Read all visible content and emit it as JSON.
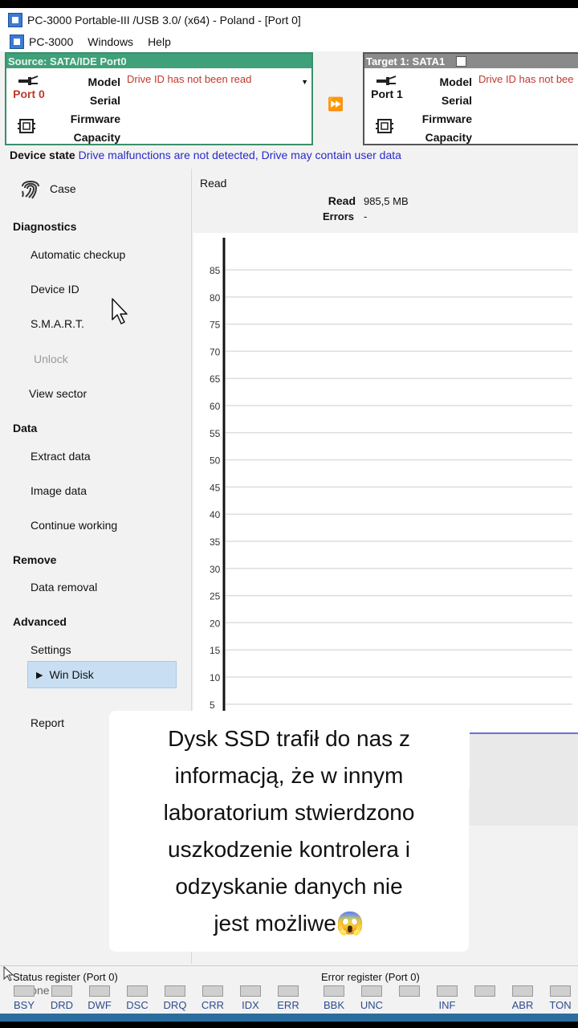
{
  "window": {
    "title": "PC-3000 Portable-III /USB 3.0/ (x64) - Poland - [Port 0]"
  },
  "menu": {
    "app": "PC-3000",
    "windows": "Windows",
    "help": "Help"
  },
  "source": {
    "header": "Source: SATA/IDE Port0",
    "port": "Port 0",
    "labels": [
      "Model",
      "Serial",
      "Firmware",
      "Capacity"
    ],
    "model_value": "Drive ID has not been read",
    "color": "#3fa07a"
  },
  "target": {
    "header": "Target 1: SATA1",
    "port": "Port 1",
    "labels": [
      "Model",
      "Serial",
      "Firmware",
      "Capacity"
    ],
    "model_value": "Drive ID has not bee"
  },
  "device_state": {
    "label": "Device state",
    "value": "Drive malfunctions are not detected, Drive may contain user data"
  },
  "sidebar": {
    "case": "Case",
    "diagnostics": "Diagnostics",
    "automatic_checkup": "Automatic checkup",
    "device_id": "Device ID",
    "smart": "S.M.A.R.T.",
    "unlock": "Unlock",
    "view_sector": "View sector",
    "data": "Data",
    "extract_data": "Extract data",
    "image_data": "Image data",
    "continue_working": "Continue working",
    "remove": "Remove",
    "data_removal": "Data removal",
    "advanced": "Advanced",
    "settings": "Settings",
    "win_disk": "Win Disk",
    "report": "Report"
  },
  "main": {
    "title": "Read",
    "read_label": "Read",
    "read_value": "985,5 MB",
    "errors_label": "Errors",
    "errors_value": "-"
  },
  "chart_data": {
    "type": "line",
    "yticks": [
      85,
      80,
      75,
      70,
      65,
      60,
      55,
      50,
      45,
      40,
      35,
      30,
      25,
      20,
      15,
      10,
      5
    ],
    "series": []
  },
  "caption": {
    "lines": [
      "Dysk SSD trafił do nas z",
      "informacją, że w innym",
      "laboratorium stwierdzono",
      "uszkodzenie kontrolera i",
      "odzyskanie danych nie",
      "jest możliwe😱"
    ]
  },
  "status": {
    "status_register": "Status register (Port 0)",
    "error_register": "Error register (Port 0)",
    "iphone": "iPhone",
    "status_leds": [
      "BSY",
      "DRD",
      "DWF",
      "DSC",
      "DRQ",
      "CRR",
      "IDX",
      "ERR"
    ],
    "error_leds": [
      "BBK",
      "UNC",
      "",
      "INF",
      "",
      "ABR",
      "TON"
    ]
  }
}
